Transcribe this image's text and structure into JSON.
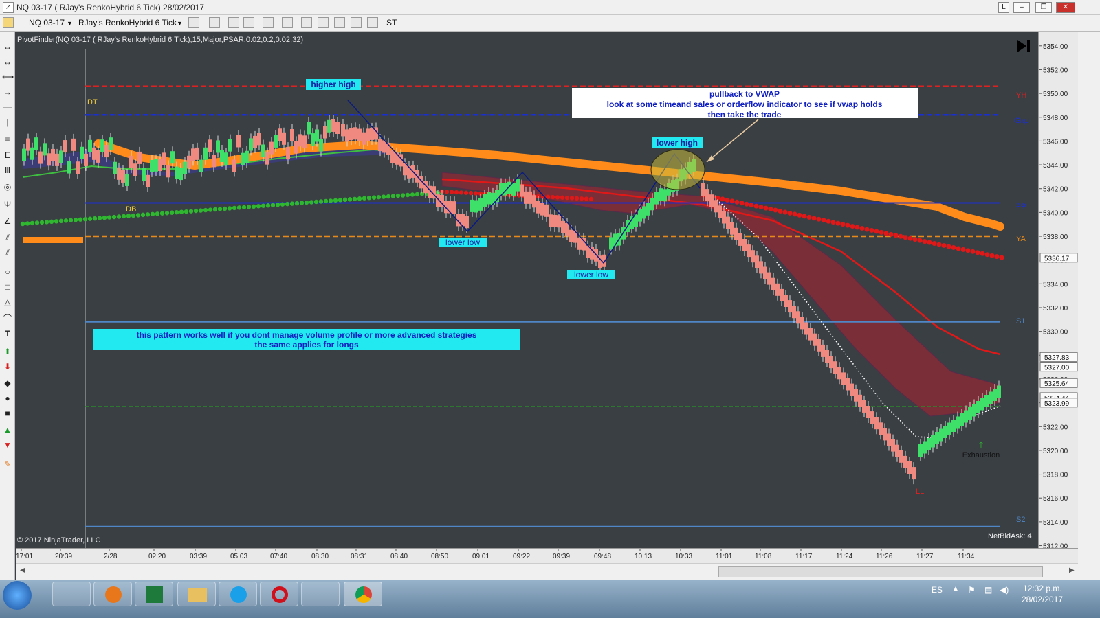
{
  "window": {
    "title": "NQ 03-17 ( RJay's RenkoHybrid  6 Tick)  28/02/2017",
    "btn_l": "L"
  },
  "toolbar": {
    "instrument": "NQ 03-17",
    "bartype": "RJay's RenkoHybrid  6 Tick",
    "st_label": "ST"
  },
  "chart": {
    "indicator_label": "PivotFinder(NQ 03-17 ( RJay's RenkoHybrid  6 Tick),15,Major,PSAR,0.02,0.2,0.02,32)",
    "copyright": "© 2017 NinjaTrader, LLC",
    "netbidask": "NetBidAsk: 4",
    "annotations": {
      "higher_high": "higher high",
      "lower_high": "lower high",
      "lower_low_1": "lower low",
      "lower_low_2": "lower low",
      "note_line1": "pullback to VWAP",
      "note_line2": "look at some timeand sales or orderflow indicator to see if vwap holds",
      "note_line3": "then take the trade",
      "pattern_line1": "this pattern works well if you dont manage volume profile or more advanced strategies",
      "pattern_line2": "the same applies for longs",
      "exhaustion": "Exhaustion",
      "dt": "DT",
      "db": "DB",
      "ll_mark": "LL"
    },
    "levels": {
      "yh": "YH",
      "gap": "Gap",
      "pp": "PP",
      "ya": "YA",
      "s1": "S1",
      "s2": "S2"
    }
  },
  "chart_data": {
    "type": "candlestick",
    "price_axis": {
      "ticks": [
        "5354.00",
        "5352.00",
        "5350.00",
        "5348.00",
        "5346.00",
        "5344.00",
        "5342.00",
        "5340.00",
        "5338.00",
        "5336.00",
        "5334.00",
        "5332.00",
        "5330.00",
        "5328.00",
        "5326.00",
        "5324.00",
        "5322.00",
        "5320.00",
        "5318.00",
        "5316.00",
        "5314.00",
        "5312.00"
      ],
      "ylim": [
        5311.8,
        5355.2
      ],
      "markers": [
        {
          "label": "5336.17",
          "value": 5336.17
        },
        {
          "label": "5327.83",
          "value": 5327.83
        },
        {
          "label": "5327.00",
          "value": 5327.0
        },
        {
          "label": "5325.64",
          "value": 5325.64
        },
        {
          "label": "5324.44",
          "value": 5324.44
        },
        {
          "label": "5323.99",
          "value": 5323.99
        }
      ]
    },
    "time_axis": {
      "ticks": [
        "17:01",
        "20:39",
        "2/28",
        "02:20",
        "03:39",
        "05:03",
        "07:40",
        "08:30",
        "08:31",
        "08:40",
        "08:50",
        "09:01",
        "09:22",
        "09:39",
        "09:48",
        "10:13",
        "10:33",
        "11:01",
        "11:08",
        "11:17",
        "11:24",
        "11:26",
        "11:27",
        "11:34"
      ]
    },
    "levels": [
      {
        "name": "YH",
        "value": 5350.6,
        "color": "#e02020"
      },
      {
        "name": "Gap",
        "value": 5348.2,
        "color": "#1a2fd0"
      },
      {
        "name": "PP",
        "value": 5340.8,
        "color": "#1a2fd0"
      },
      {
        "name": "YA",
        "value": 5338.0,
        "color": "#e88a1a"
      },
      {
        "name": "S1",
        "value": 5330.8,
        "color": "#4f86c6"
      },
      {
        "name": "S2",
        "value": 5313.6,
        "color": "#4f86c6"
      }
    ],
    "colors": {
      "up": "#3ee06a",
      "down": "#f08a80",
      "psar_green": "#2fb82f",
      "psar_red": "#e01818",
      "band_orange": "#ff8c1a",
      "vwap_red": "#e01818",
      "zigzag": "#0a1a80",
      "background": "#3a3f44"
    }
  }
}
